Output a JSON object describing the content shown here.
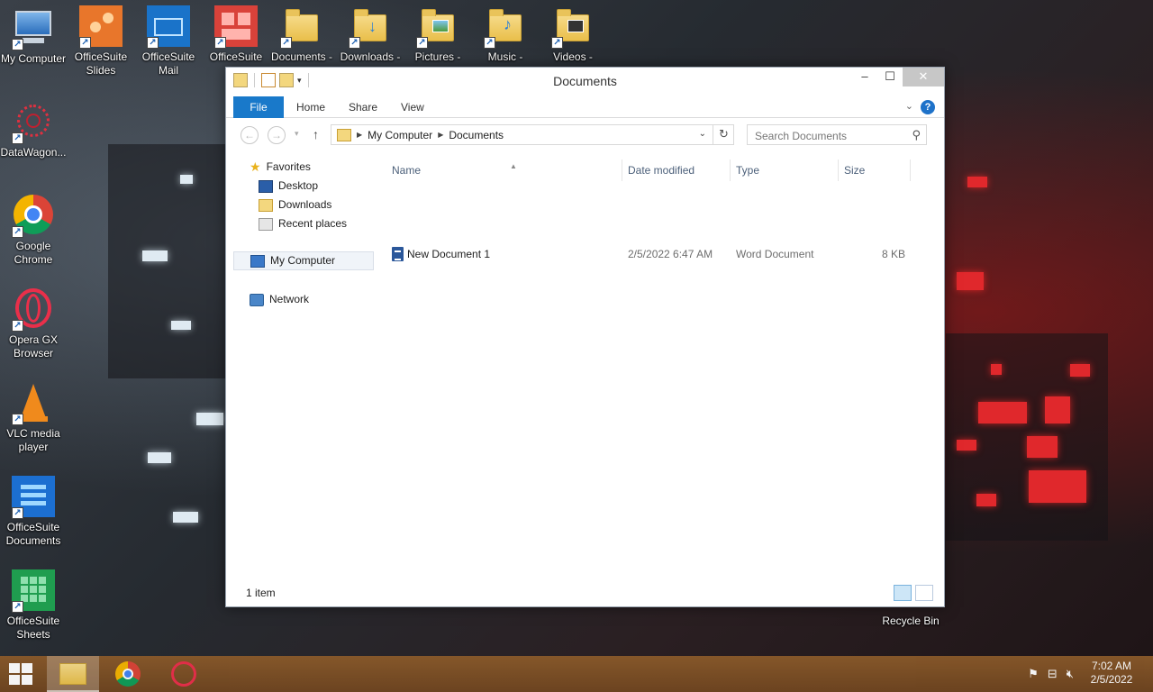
{
  "desktop": {
    "icons_left": [
      {
        "label": "My Computer",
        "icon": "monitor-icon"
      },
      {
        "label": "DataWagon...",
        "icon": "datawagon-icon"
      },
      {
        "label": "Google Chrome",
        "icon": "chrome-icon"
      },
      {
        "label": "Opera GX Browser",
        "icon": "opera-icon"
      },
      {
        "label": "VLC media player",
        "icon": "vlc-icon"
      },
      {
        "label": "OfficeSuite Documents",
        "icon": "officesuite-documents-icon"
      },
      {
        "label": "OfficeSuite Sheets",
        "icon": "officesuite-sheets-icon"
      }
    ],
    "icons_top": [
      {
        "label": "OfficeSuite Slides",
        "icon": "officesuite-slides-icon"
      },
      {
        "label": "OfficeSuite Mail",
        "icon": "officesuite-mail-icon"
      },
      {
        "label": "OfficeSuite",
        "icon": "officesuite-icon"
      },
      {
        "label": "Documents -",
        "icon": "documents-folder-icon"
      },
      {
        "label": "Downloads -",
        "icon": "downloads-folder-icon"
      },
      {
        "label": "Pictures -",
        "icon": "pictures-folder-icon"
      },
      {
        "label": "Music -",
        "icon": "music-folder-icon"
      },
      {
        "label": "Videos -",
        "icon": "videos-folder-icon"
      }
    ],
    "recycle_bin": "Recycle Bin"
  },
  "window": {
    "title": "Documents",
    "controls": {
      "minimize": "–",
      "maximize": "☐",
      "close": "✕"
    },
    "ribbon_tabs": [
      "File",
      "Home",
      "Share",
      "View"
    ],
    "help": "?",
    "address": {
      "crumbs": [
        "My Computer",
        "Documents"
      ]
    },
    "search_placeholder": "Search Documents",
    "nav": {
      "favorites": "Favorites",
      "favorites_items": [
        "Desktop",
        "Downloads",
        "Recent places"
      ],
      "my_computer": "My Computer",
      "network": "Network"
    },
    "columns": [
      "Name",
      "Date modified",
      "Type",
      "Size"
    ],
    "files": [
      {
        "name": "New Document 1",
        "date": "2/5/2022 6:47 AM",
        "type": "Word Document",
        "size": "8 KB"
      }
    ],
    "status": "1 item"
  },
  "taskbar": {
    "apps": [
      "file-explorer-icon",
      "chrome-icon",
      "opera-icon"
    ],
    "time": "7:02 AM",
    "date": "2/5/2022"
  },
  "colors": {
    "file_tab": "#1979ca",
    "taskbar": "#7a4d24",
    "word_blue": "#2b579a"
  }
}
